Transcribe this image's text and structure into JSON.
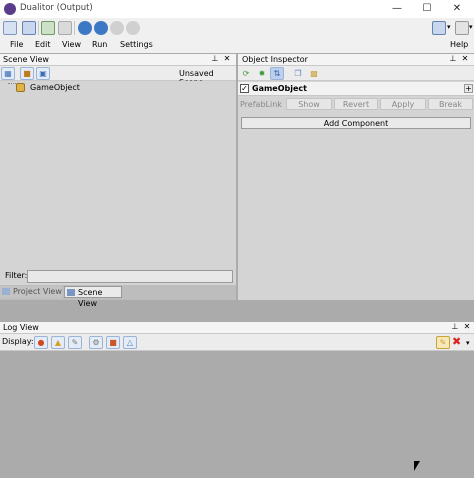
{
  "window": {
    "title": "Dualitor (Output)"
  },
  "menu": {
    "file": "File",
    "edit": "Edit",
    "view": "View",
    "run": "Run",
    "settings": "Settings",
    "help": "Help"
  },
  "scene_view": {
    "title": "Scene View",
    "status": "Unsaved Scene",
    "items": [
      {
        "label": "GameObject"
      }
    ],
    "filter_label": "Filter:",
    "filter_value": "",
    "tabs": [
      {
        "label": "Project View"
      },
      {
        "label": "Scene View"
      }
    ]
  },
  "object_inspector": {
    "title": "Object Inspector",
    "object_name": "GameObject",
    "object_checked": true,
    "prefab_buttons": [
      {
        "label": "PrefabLink"
      },
      {
        "label": "Show"
      },
      {
        "label": "Revert"
      },
      {
        "label": "Apply"
      },
      {
        "label": "Break"
      }
    ],
    "add_component_label": "Add Component"
  },
  "log_view": {
    "title": "Log View",
    "display_label": "Display:"
  },
  "colors": {
    "panel_bg": "#d4d4d4",
    "workspace_bg": "#ababab",
    "accent": "#5a3d8a"
  }
}
